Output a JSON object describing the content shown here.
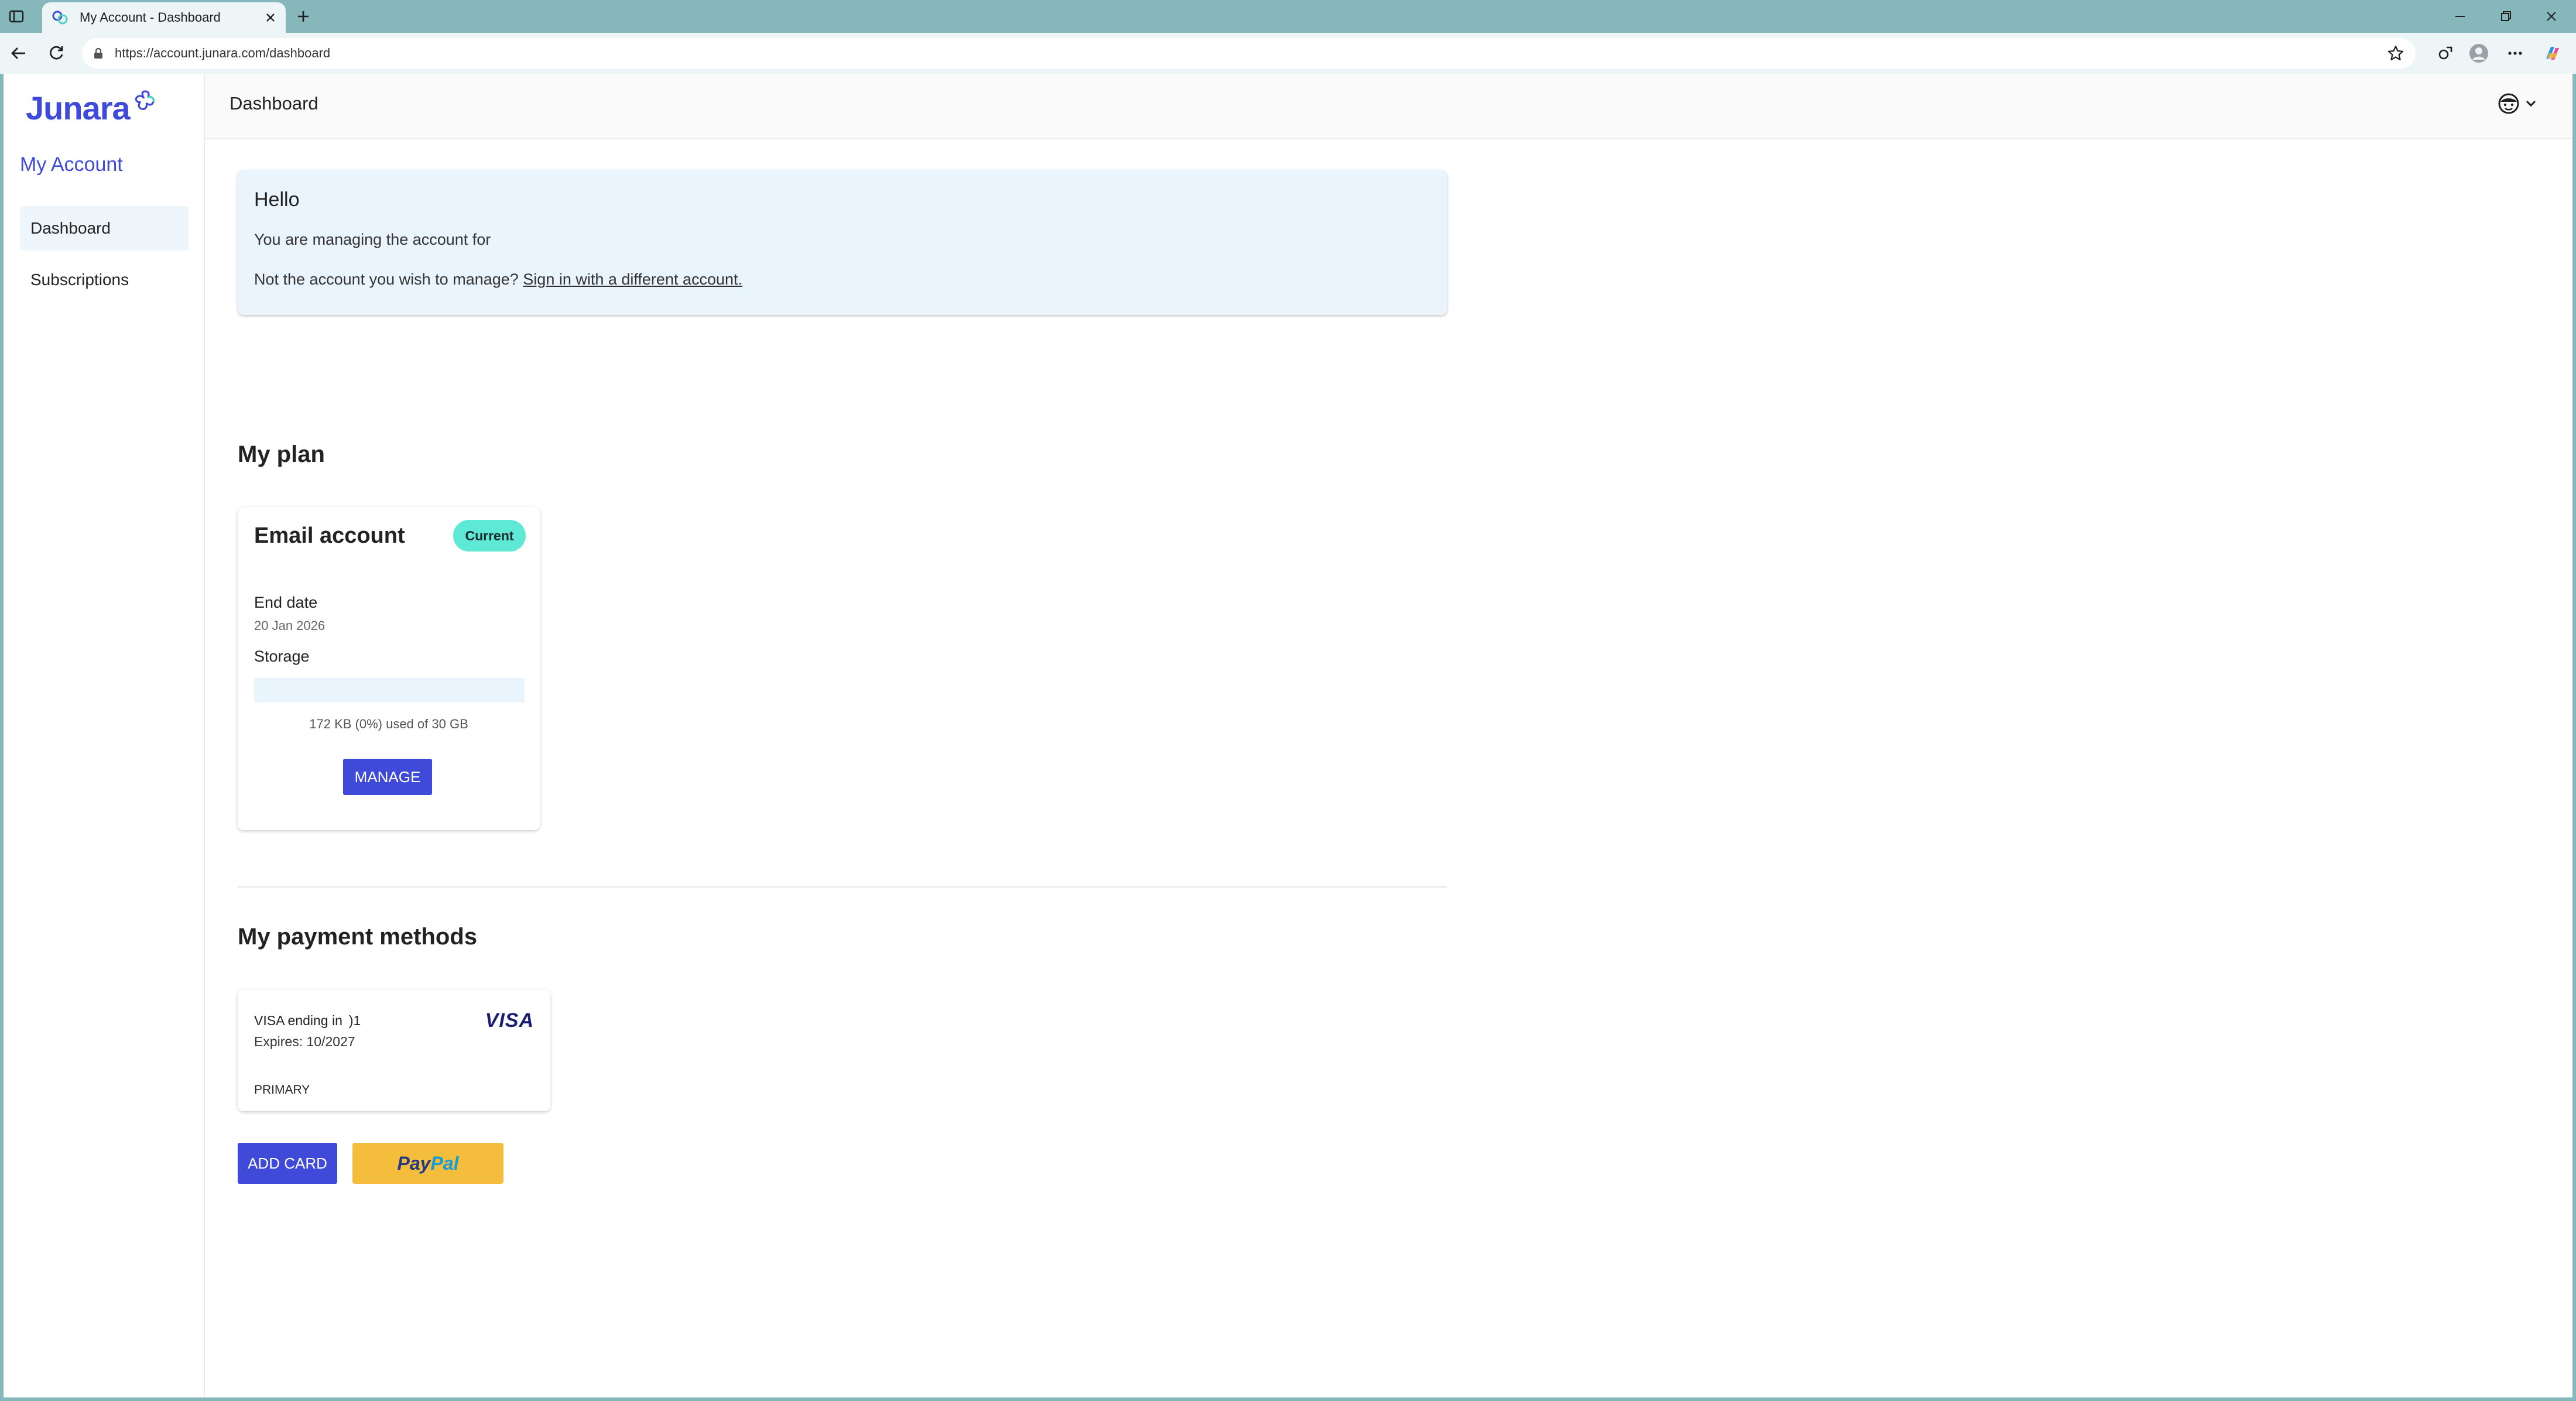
{
  "browser": {
    "tab_title": "My Account - Dashboard",
    "url": "https://account.junara.com/dashboard"
  },
  "brand": {
    "logo_text": "Junara",
    "accent_color": "#3f4bd8"
  },
  "sidebar": {
    "heading": "My Account",
    "items": [
      {
        "label": "Dashboard",
        "active": true
      },
      {
        "label": "Subscriptions",
        "active": false
      }
    ]
  },
  "header": {
    "title": "Dashboard"
  },
  "hello": {
    "title": "Hello",
    "managing_text": "You are managing the account for",
    "not_you_text": "Not the account you wish to manage?",
    "switch_link": "Sign in with a different account."
  },
  "plan": {
    "section_title": "My plan",
    "name": "Email account",
    "badge": "Current",
    "end_date_label": "End date",
    "end_date_value": "20 Jan 2026",
    "storage_label": "Storage",
    "storage_used_fraction": 0,
    "storage_text": "172 KB (0%) used of 30 GB",
    "manage_button": "MANAGE"
  },
  "payment": {
    "section_title": "My payment methods",
    "card_brand_line": "VISA  ending in    )1",
    "expires": "Expires: 10/2027",
    "primary_label": "PRIMARY",
    "card_logo": "VISA",
    "add_card_button": "ADD CARD",
    "paypal_pay": "Pay",
    "paypal_pal": "Pal"
  }
}
